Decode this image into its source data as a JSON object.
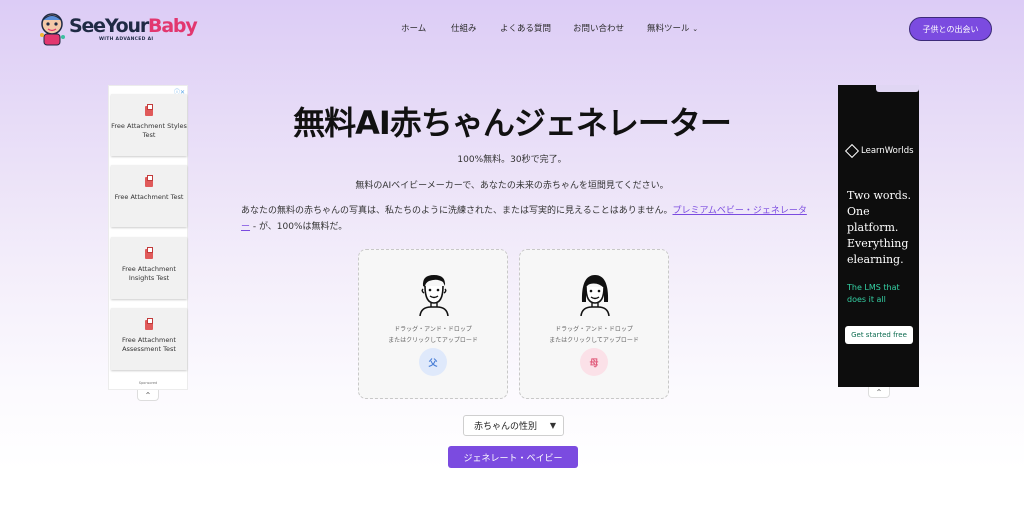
{
  "header": {
    "logo": {
      "name_part1": "See",
      "name_part2": "Your",
      "name_part3": "Baby",
      "tagline": "WITH ADVANCED AI"
    },
    "nav": [
      {
        "label": "ホーム"
      },
      {
        "label": "仕組み"
      },
      {
        "label": "よくある質問"
      },
      {
        "label": "お問い合わせ"
      },
      {
        "label": "無料ツール"
      }
    ],
    "cta_label": "子供との出会い",
    "colors": {
      "accent": "#7b4be0",
      "brand_pink": "#e2376f",
      "brand_navy": "#1f2a44"
    }
  },
  "left_ad": {
    "info_icon": "ⓘ✕",
    "cards": [
      {
        "icon": "document-icon",
        "label": "Free Attachment Styles Test"
      },
      {
        "icon": "document-icon",
        "label": "Free Attachment Test"
      },
      {
        "icon": "document-icon",
        "label": "Free Attachment Insights Test"
      },
      {
        "icon": "document-icon",
        "label": "Free Attachment Assessment Test"
      }
    ],
    "sponsored": "Sponsored",
    "collapse_icon": "chevron-up-icon"
  },
  "right_ad": {
    "brand": "LearnWorlds",
    "headline": "Two words. One platform. Everything elearning.",
    "tagline": "The LMS that does it all",
    "button": "Get started free"
  },
  "main": {
    "title": "無料AI赤ちゃんジェネレーター",
    "subtitle": "100%無料。30秒で完了。",
    "desc1": "無料のAIベイビーメーカーで、あなたの未来の赤ちゃんを垣間見てください。",
    "desc2_before": "あなたの無料の赤ちゃんの写真は、私たちのように洗練された、または写実的に見えることはありません。",
    "desc2_link": "プレミアムベビー・ジェネレーター",
    "desc2_after": " - が、100%は無料だ。",
    "uploads": [
      {
        "hint_line1": "ドラッグ・アンド・ドロップ",
        "hint_line2": "またはクリックしてアップロード",
        "badge": "父",
        "icon": "father-face-icon"
      },
      {
        "hint_line1": "ドラッグ・アンド・ドロップ",
        "hint_line2": "またはクリックしてアップロード",
        "badge": "母",
        "icon": "mother-face-icon"
      }
    ],
    "gender_select": {
      "selected": "赤ちゃんの性別"
    },
    "generate_button": "ジェネレート・ベイビー"
  }
}
